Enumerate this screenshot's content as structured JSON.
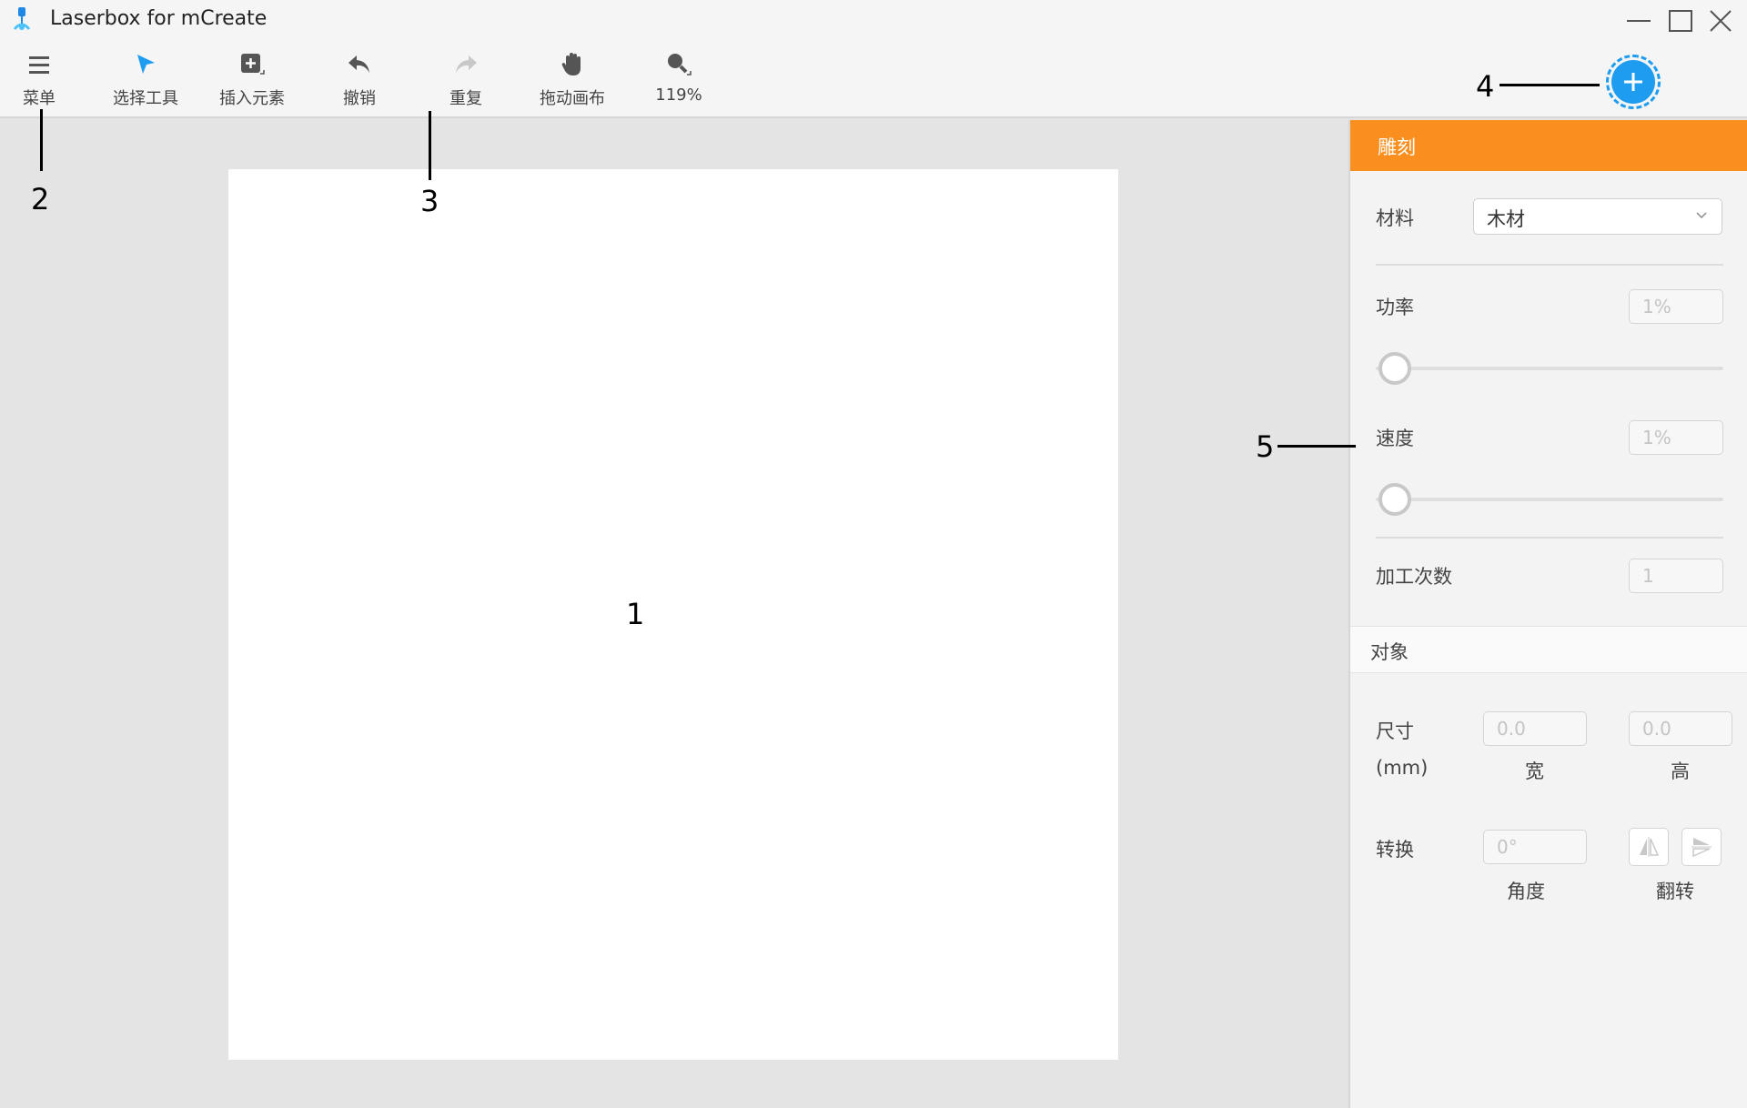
{
  "app": {
    "title": "Laserbox for mCreate"
  },
  "toolbar": {
    "menu": "菜单",
    "select_tool": "选择工具",
    "insert_element": "插入元素",
    "undo": "撤销",
    "redo": "重复",
    "pan_canvas": "拖动画布",
    "zoom": "119%"
  },
  "callouts": {
    "c1": "1",
    "c2": "2",
    "c3": "3",
    "c4": "4",
    "c5": "5"
  },
  "panel": {
    "header": "雕刻",
    "material_label": "材料",
    "material_value": "木材",
    "power_label": "功率",
    "power_value": "1%",
    "power_level": 0.01,
    "speed_label": "速度",
    "speed_value": "1%",
    "speed_level": 0.01,
    "passes_label": "加工次数",
    "passes_value": "1",
    "object_section": "对象",
    "size_label": "尺寸",
    "size_unit": "(mm)",
    "width_value": "0.0",
    "width_label": "宽",
    "height_value": "0.0",
    "height_label": "高",
    "transform_label": "转换",
    "angle_value": "0°",
    "angle_label": "角度",
    "flip_label": "翻转"
  },
  "colors": {
    "accent": "#1e9cf0",
    "header": "#fa8f1f"
  }
}
